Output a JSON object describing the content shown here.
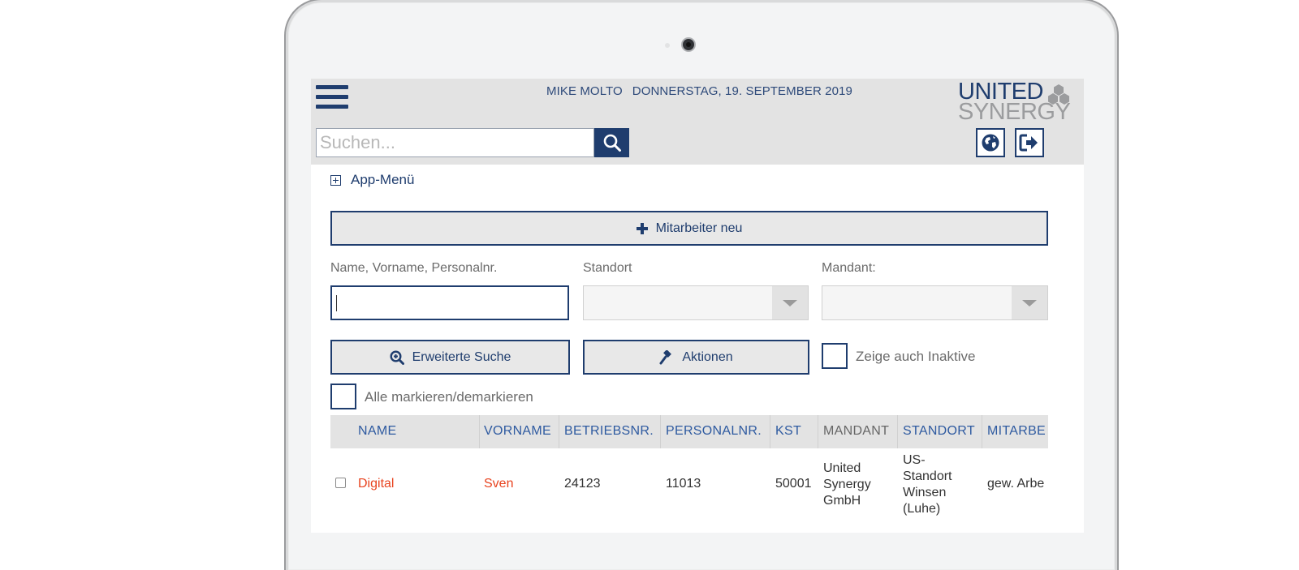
{
  "header": {
    "user": "MIKE MOLTO",
    "date": "DONNERSTAG, 19. SEPTEMBER 2019",
    "logo_line1": "UNITED",
    "logo_line2": "SYNERGY",
    "search_placeholder": "Suchen..."
  },
  "app_menu_label": "App-Menü",
  "new_employee_button": "Mitarbeiter neu",
  "filters": {
    "name_label": "Name, Vorname, Personalnr.",
    "name_value": "",
    "standort_label": "Standort",
    "standort_value": "",
    "mandant_label": "Mandant:",
    "mandant_value": ""
  },
  "buttons": {
    "extended_search": "Erweiterte Suche",
    "actions": "Aktionen"
  },
  "show_inactive_label": "Zeige auch Inaktive",
  "select_all_label": "Alle markieren/demarkieren",
  "table": {
    "columns": [
      "NAME",
      "VORNAME",
      "BETRIEBSNR.",
      "PERSONALNR.",
      "KST",
      "MANDANT",
      "STANDORT",
      "MITARBE"
    ],
    "rows": [
      {
        "name": "Digital",
        "vorname": "Sven",
        "betriebsnr": "24123",
        "personalnr": "11013",
        "kst": "50001",
        "mandant_lines": [
          "United",
          "Synergy",
          "GmbH"
        ],
        "standort_lines": [
          "US-",
          "Standort",
          "Winsen",
          "(Luhe)"
        ],
        "mitarbeiter": "gew. Arbe"
      }
    ]
  },
  "colors": {
    "primary": "#1f3d6e",
    "header_bg": "#e3e3e3",
    "name_red": "#e8431f",
    "column_blue": "#2e5aa0"
  },
  "icons": {
    "menu": "hamburger-icon",
    "search": "search-icon",
    "language": "globe-icon",
    "logout": "logout-icon",
    "new": "plus-icon",
    "extended_search": "zoom-in-icon",
    "actions": "gavel-icon",
    "app_menu": "plus-square-icon"
  }
}
